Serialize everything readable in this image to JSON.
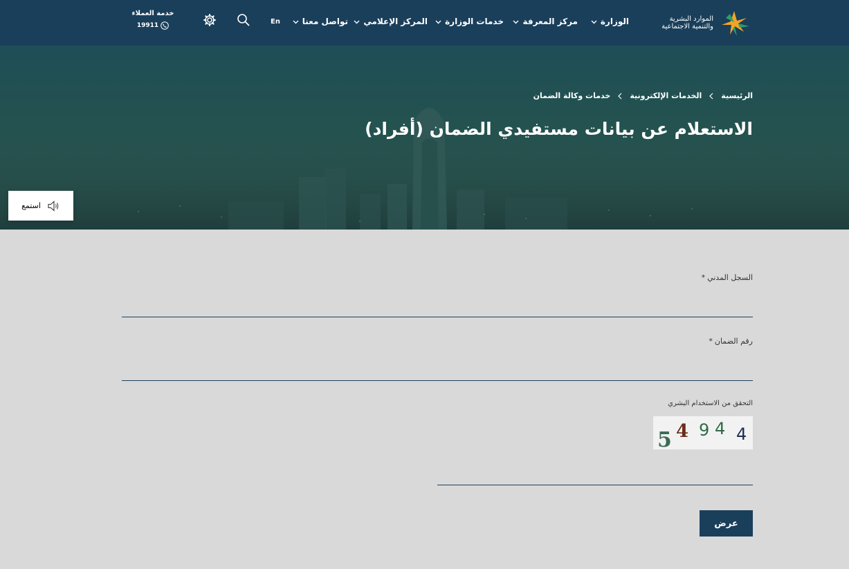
{
  "header": {
    "logo_text_line1": "الموارد البشرية",
    "logo_text_line2": "والتنمية الاجتماعية",
    "nav": [
      {
        "label": "الوزارة"
      },
      {
        "label": "مركز المعرفة"
      },
      {
        "label": "خدمات الوزارة"
      },
      {
        "label": "المركز الإعلامي"
      },
      {
        "label": "تواصل معنا"
      }
    ],
    "lang_toggle": "En",
    "customer_service_label": "خدمة العملاء",
    "customer_service_number": "19911",
    "colors": {
      "header_bg": "#1a3f5b",
      "accent_green": "#2e9a6b",
      "accent_orange": "#f4a425"
    }
  },
  "breadcrumb": [
    "الرئيسية",
    "الخدمات الإلكترونية",
    "خدمات وكالة الضمان"
  ],
  "page_title": "الاستعلام عن بيانات مستفيدي الضمان (أفراد)",
  "listen_label": "استمع",
  "form": {
    "civil_id_label": "السجل المدني",
    "civil_id_value": "",
    "guarantee_no_label": "رقم الضمان",
    "guarantee_no_value": "",
    "required_mark": "*",
    "captcha_label": "التحقق من الاستخدام البشري",
    "captcha_digits": [
      "5",
      "4",
      "9",
      "4",
      "4"
    ],
    "captcha_value": "",
    "submit_label": "عرض"
  }
}
